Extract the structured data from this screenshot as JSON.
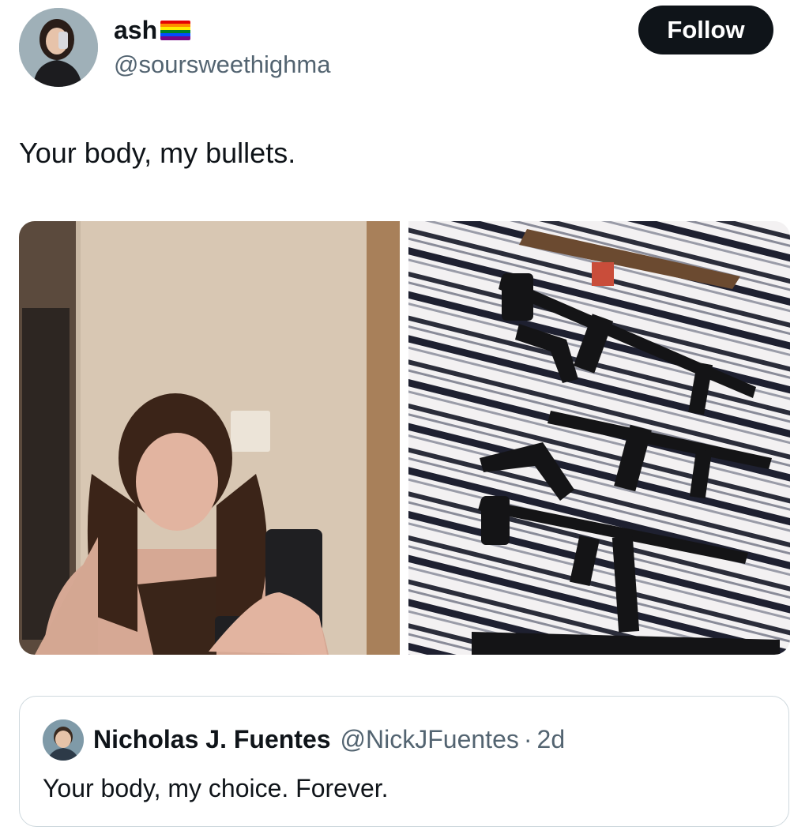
{
  "author": {
    "display_name": "ash",
    "name_emoji": "rainbow-flag",
    "handle": "@soursweethighma"
  },
  "follow_button": {
    "label": "Follow"
  },
  "tweet": {
    "text": "Your body, my bullets."
  },
  "media": [
    {
      "kind": "photo",
      "subject": "woman holding handgun"
    },
    {
      "kind": "photo",
      "subject": "firearms laid on striped blanket"
    }
  ],
  "quoted_tweet": {
    "display_name": "Nicholas J. Fuentes",
    "handle": "@NickJFuentes",
    "separator": "·",
    "time": "2d",
    "text": "Your body, my choice. Forever."
  },
  "colors": {
    "text_primary": "#0f1419",
    "text_secondary": "#536471",
    "follow_bg": "#0f1419",
    "follow_text": "#ffffff",
    "card_border": "#cfd9de",
    "pride_flag": [
      "#e40303",
      "#ff8c00",
      "#ffed00",
      "#008026",
      "#004dff",
      "#750787"
    ]
  }
}
